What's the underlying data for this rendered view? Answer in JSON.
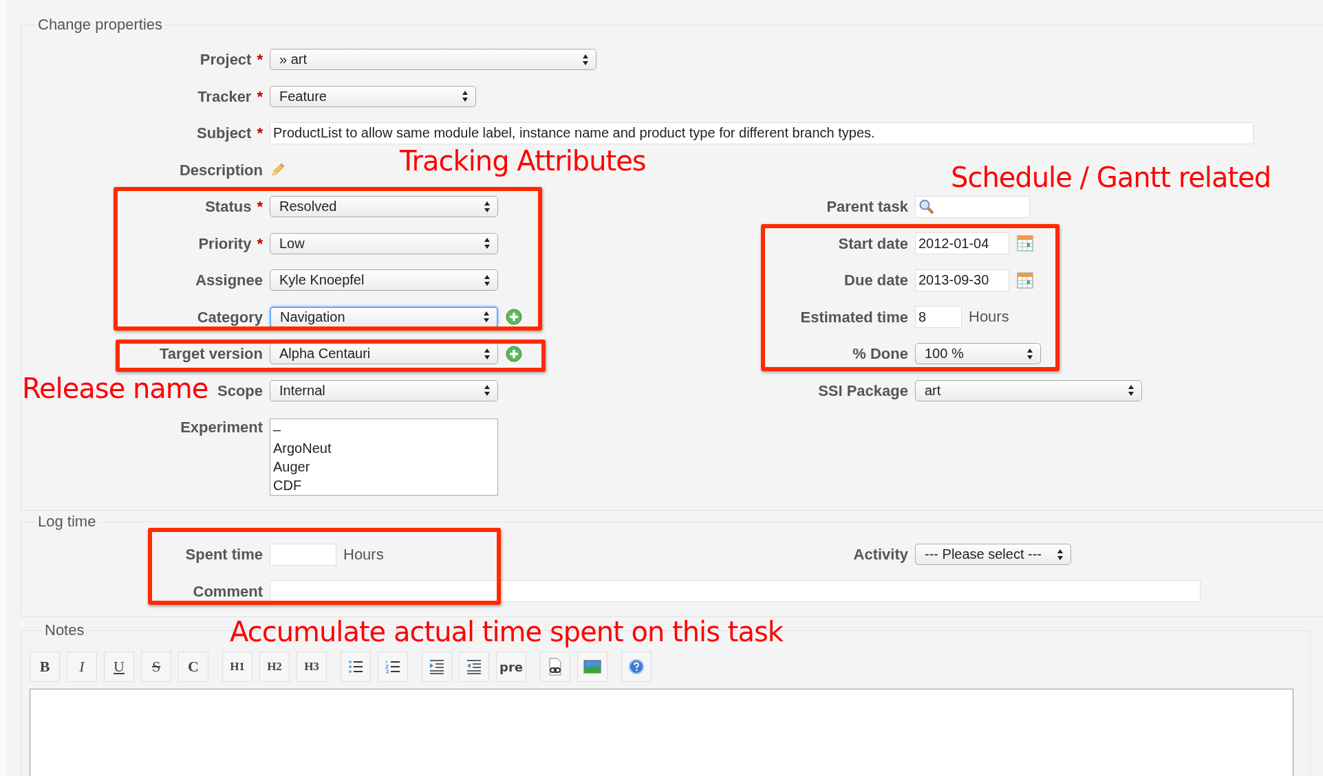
{
  "change_properties": {
    "legend": "Change properties",
    "top_fields": [
      {
        "label": "Project",
        "marker": "*",
        "kind": "select",
        "value": "» art",
        "focused": false
      },
      {
        "label": "Tracker",
        "marker": "*",
        "kind": "select",
        "value": "Feature",
        "focused": false
      },
      {
        "label": "Subject",
        "marker": "*",
        "kind": "text",
        "value": "ProductList to allow same module label, instance name and product type for different branch types."
      },
      {
        "label": "Description",
        "kind": "edit"
      }
    ],
    "left_fields": [
      {
        "label": "Status",
        "marker": "*",
        "kind": "select",
        "value": "Resolved",
        "focused": false,
        "add": false
      },
      {
        "label": "Priority",
        "marker": "*",
        "kind": "select",
        "value": "Low",
        "focused": false,
        "add": false
      },
      {
        "label": "Assignee",
        "kind": "select",
        "value": "Kyle Knoepfel",
        "focused": false,
        "add": false
      },
      {
        "label": "Category",
        "kind": "select",
        "value": "Navigation",
        "focused": true,
        "add": true
      },
      {
        "label": "Target version",
        "kind": "select",
        "value": "Alpha Centauri",
        "focused": false,
        "add": true
      },
      {
        "label": "Scope",
        "kind": "select",
        "value": "Internal",
        "focused": false,
        "add": false
      },
      {
        "label": "Experiment",
        "kind": "listbox",
        "options": [
          "–",
          "ArgoNeut",
          "Auger",
          "CDF"
        ]
      }
    ],
    "right_fields": [
      {
        "label": "Parent task",
        "kind": "search"
      },
      {
        "label": "Start date",
        "kind": "date",
        "value": "2012-01-04"
      },
      {
        "label": "Due date",
        "kind": "date",
        "value": "2013-09-30"
      },
      {
        "label": "Estimated time",
        "kind": "hours",
        "value": "8",
        "unit": "Hours"
      },
      {
        "label": "% Done",
        "kind": "select",
        "value": "100 %"
      },
      {
        "label": "SSI Package",
        "kind": "select",
        "value": "art"
      }
    ]
  },
  "log_time": {
    "legend": "Log time",
    "spent_label": "Spent time",
    "spent_unit": "Hours",
    "activity_label": "Activity",
    "activity_value": "--- Please select ---",
    "comment_label": "Comment"
  },
  "notes": {
    "legend": "Notes",
    "toolbar": [
      {
        "kind": "bold",
        "label": "B"
      },
      {
        "kind": "italic",
        "label": "I"
      },
      {
        "kind": "underline",
        "label": "U"
      },
      {
        "kind": "strike",
        "label": "S"
      },
      {
        "kind": "code",
        "label": "C"
      },
      {
        "kind": "heading",
        "label": "H1"
      },
      {
        "kind": "heading",
        "label": "H2"
      },
      {
        "kind": "heading",
        "label": "H3"
      },
      {
        "kind": "ul"
      },
      {
        "kind": "ol"
      },
      {
        "kind": "indent"
      },
      {
        "kind": "outdent"
      },
      {
        "kind": "pre",
        "label": "pre"
      },
      {
        "kind": "link"
      },
      {
        "kind": "image"
      },
      {
        "kind": "help"
      }
    ]
  },
  "annotations": [
    "Tracking Attributes",
    "Schedule / Gantt related",
    "Release name",
    "Accumulate actual time spent on this task"
  ]
}
